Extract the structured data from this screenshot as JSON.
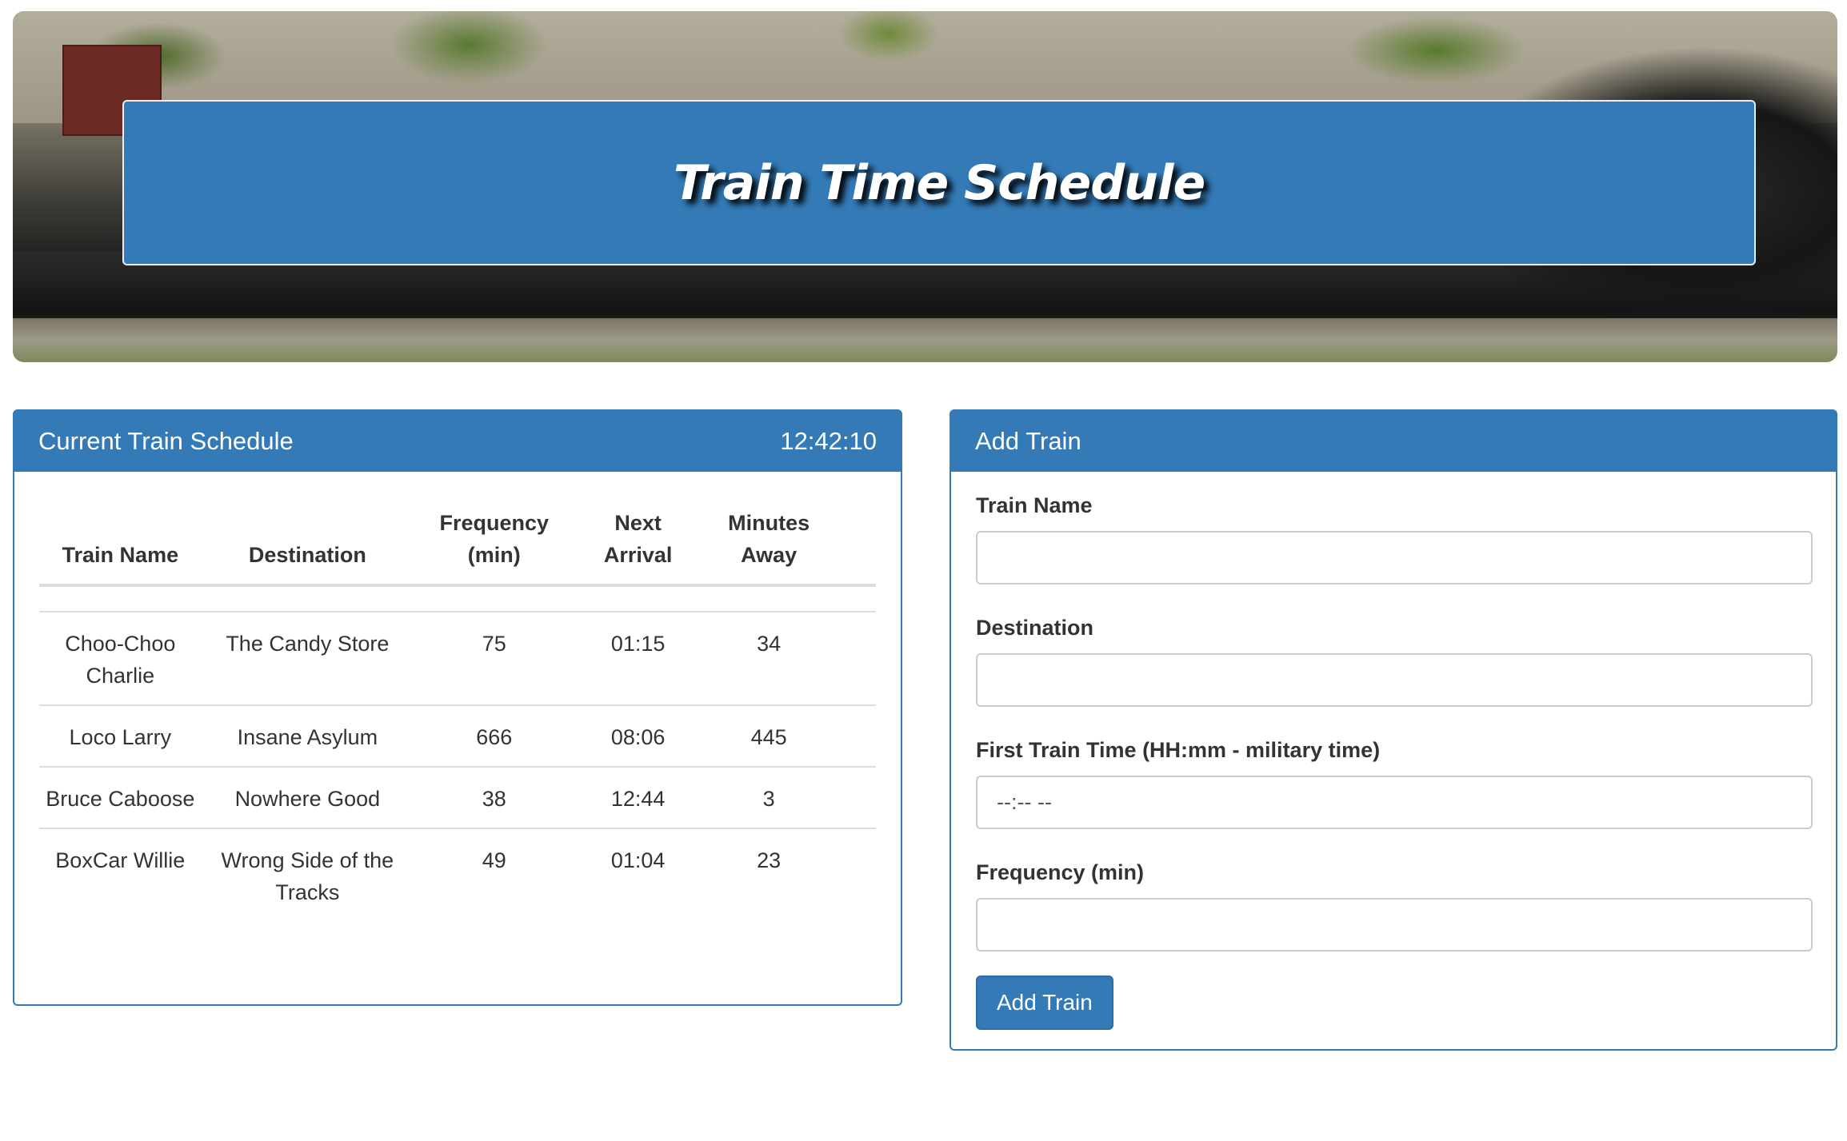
{
  "header": {
    "title": "Train Time Schedule"
  },
  "schedule": {
    "heading": "Current Train Schedule",
    "clock": "12:42:10",
    "columns": {
      "name": "Train Name",
      "destination": "Destination",
      "frequency_1": "Frequency",
      "frequency_2": "(min)",
      "next_1": "Next",
      "next_2": "Arrival",
      "minutes_1": "Minutes",
      "minutes_2": "Away"
    },
    "rows": [
      {
        "name": "Choo-Choo Charlie",
        "destination": "The Candy Store",
        "frequency": "75",
        "next": "01:15",
        "minutes": "34"
      },
      {
        "name": "Loco Larry",
        "destination": "Insane Asylum",
        "frequency": "666",
        "next": "08:06",
        "minutes": "445"
      },
      {
        "name": "Bruce Caboose",
        "destination": "Nowhere Good",
        "frequency": "38",
        "next": "12:44",
        "minutes": "3"
      },
      {
        "name": "BoxCar Willie",
        "destination": "Wrong Side of the Tracks",
        "frequency": "49",
        "next": "01:04",
        "minutes": "23"
      }
    ]
  },
  "add_train": {
    "heading": "Add Train",
    "name_label": "Train Name",
    "name_value": "",
    "destination_label": "Destination",
    "destination_value": "",
    "first_time_label": "First Train Time (HH:mm - military time)",
    "first_time_value": "--:-- --",
    "frequency_label": "Frequency (min)",
    "frequency_value": "",
    "submit_label": "Add Train"
  },
  "colors": {
    "primary": "#337ab7",
    "border": "#dddddd"
  }
}
